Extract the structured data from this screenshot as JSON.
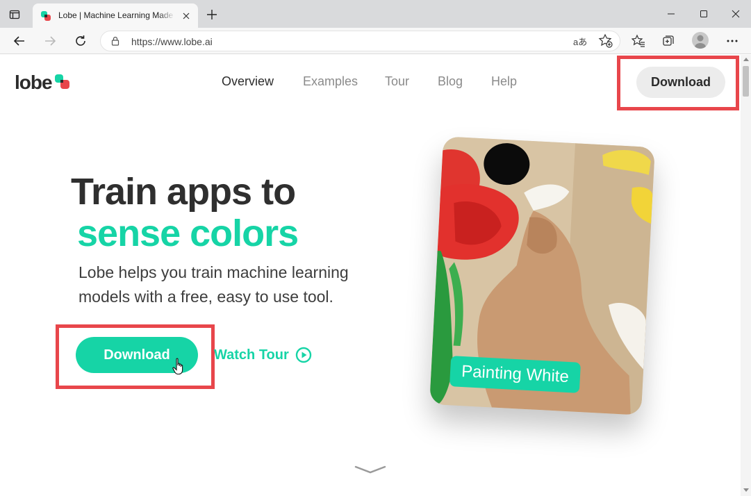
{
  "browser": {
    "tab_title": "Lobe | Machine Learning Made Easy",
    "url": "https://www.lobe.ai",
    "read_aloud_glyph": "aあ",
    "icons": [
      "sidebar-icon",
      "lobe-favicon",
      "close-icon",
      "plus-icon",
      "minimize-icon",
      "maximize-icon",
      "close-window-icon",
      "back-icon",
      "forward-icon",
      "refresh-icon",
      "lock-icon",
      "read-aloud-icon",
      "add-favorite-icon",
      "favorites-icon",
      "collections-icon",
      "profile-icon",
      "more-icon"
    ]
  },
  "header": {
    "logo_text": "lobe",
    "nav": [
      "Overview",
      "Examples",
      "Tour",
      "Blog",
      "Help"
    ],
    "download_label": "Download"
  },
  "hero": {
    "title_line1": "Train apps to",
    "title_line2": "sense colors",
    "subtitle": "Lobe helps you train machine learning models with a free, easy to use tool.",
    "download_label": "Download",
    "watch_tour_label": "Watch Tour",
    "card_label": "Painting White"
  },
  "colors": {
    "accent": "#16d4a6",
    "highlight": "#e8464b",
    "text_dark": "#2f2f2f",
    "nav_inactive": "#8a8a8a"
  }
}
